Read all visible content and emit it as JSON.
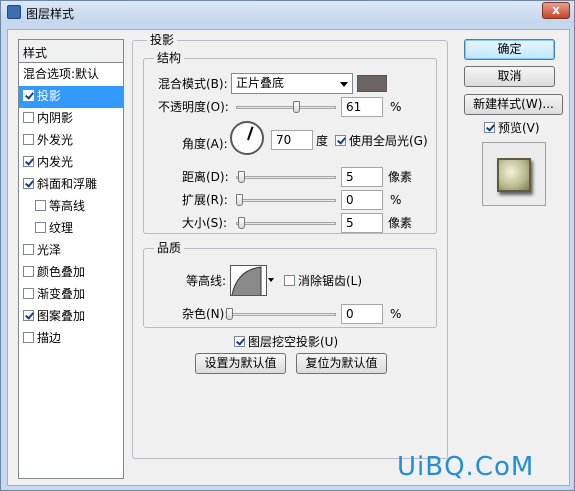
{
  "window": {
    "title": "图层样式",
    "close_glyph": "x"
  },
  "styles_list": {
    "header": "样式",
    "items": [
      {
        "label": "混合选项:默认",
        "checkbox": false,
        "checked": false,
        "selected": false,
        "indent": false
      },
      {
        "label": "投影",
        "checkbox": true,
        "checked": true,
        "selected": true,
        "indent": false
      },
      {
        "label": "内阴影",
        "checkbox": true,
        "checked": false,
        "selected": false,
        "indent": false
      },
      {
        "label": "外发光",
        "checkbox": true,
        "checked": false,
        "selected": false,
        "indent": false
      },
      {
        "label": "内发光",
        "checkbox": true,
        "checked": true,
        "selected": false,
        "indent": false
      },
      {
        "label": "斜面和浮雕",
        "checkbox": true,
        "checked": true,
        "selected": false,
        "indent": false
      },
      {
        "label": "等高线",
        "checkbox": true,
        "checked": false,
        "selected": false,
        "indent": true
      },
      {
        "label": "纹理",
        "checkbox": true,
        "checked": false,
        "selected": false,
        "indent": true
      },
      {
        "label": "光泽",
        "checkbox": true,
        "checked": false,
        "selected": false,
        "indent": false
      },
      {
        "label": "颜色叠加",
        "checkbox": true,
        "checked": false,
        "selected": false,
        "indent": false
      },
      {
        "label": "渐变叠加",
        "checkbox": true,
        "checked": false,
        "selected": false,
        "indent": false
      },
      {
        "label": "图案叠加",
        "checkbox": true,
        "checked": true,
        "selected": false,
        "indent": false
      },
      {
        "label": "描边",
        "checkbox": true,
        "checked": false,
        "selected": false,
        "indent": false
      }
    ]
  },
  "drop_shadow": {
    "title": "投影",
    "structure": {
      "title": "结构",
      "blend_mode_label": "混合模式(B):",
      "blend_mode_value": "正片叠底",
      "shadow_color": "#6b6463",
      "opacity_label": "不透明度(O):",
      "opacity_value": "61",
      "opacity_unit": "%",
      "opacity_level": 0.61,
      "angle_label": "角度(A):",
      "angle_value": "70",
      "angle_unit": "度",
      "global_light_label": "使用全局光(G)",
      "global_light_checked": true,
      "distance_label": "距离(D):",
      "distance_value": "5",
      "distance_unit": "像素",
      "distance_level": 0.02,
      "spread_label": "扩展(R):",
      "spread_value": "0",
      "spread_unit": "%",
      "spread_level": 0,
      "size_label": "大小(S):",
      "size_value": "5",
      "size_unit": "像素",
      "size_level": 0.02
    },
    "quality": {
      "title": "品质",
      "contour_label": "等高线:",
      "anti_alias_label": "消除锯齿(L)",
      "anti_alias_checked": false,
      "noise_label": "杂色(N):",
      "noise_value": "0",
      "noise_unit": "%",
      "noise_level": 0
    },
    "knockout_label": "图层挖空投影(U)",
    "knockout_checked": true,
    "make_default_label": "设置为默认值",
    "reset_default_label": "复位为默认值"
  },
  "buttons": {
    "ok": "确定",
    "cancel": "取消",
    "new_style": "新建样式(W)...",
    "preview_label": "预览(V)",
    "preview_checked": true
  },
  "watermark": "UiBQ.CoM"
}
